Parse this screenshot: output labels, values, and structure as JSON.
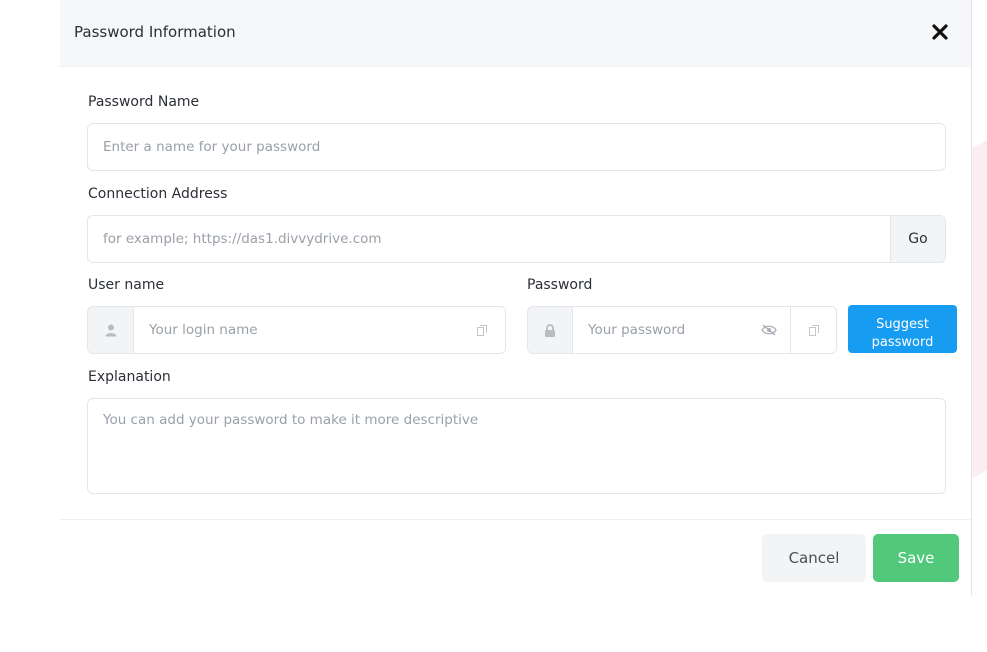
{
  "dialog": {
    "title": "Password Information",
    "close_icon": "close-icon"
  },
  "fields": {
    "password_name": {
      "label": "Password Name",
      "placeholder": "Enter a name for your password",
      "value": ""
    },
    "connection_address": {
      "label": "Connection Address",
      "placeholder": "for example; https://das1.divvydrive.com",
      "value": "",
      "go_label": "Go"
    },
    "username": {
      "label": "User name",
      "placeholder": "Your login name",
      "value": "",
      "leading_icon": "user-icon",
      "trailing_icon": "copy-icon"
    },
    "password": {
      "label": "Password",
      "placeholder": "Your password",
      "value": "",
      "leading_icon": "lock-icon",
      "visibility_icon": "eye-slash-icon",
      "trailing_icon": "copy-icon",
      "suggest_label_line1": "Suggest",
      "suggest_label_line2": "password"
    },
    "explanation": {
      "label": "Explanation",
      "placeholder": "You can add your password to make it more descriptive",
      "value": ""
    }
  },
  "footer": {
    "cancel_label": "Cancel",
    "save_label": "Save"
  },
  "colors": {
    "header_bg": "#f6f7f8",
    "suggest_button": "#169cf0",
    "save_button": "#52c97a",
    "cancel_button": "#f3f4f6"
  }
}
